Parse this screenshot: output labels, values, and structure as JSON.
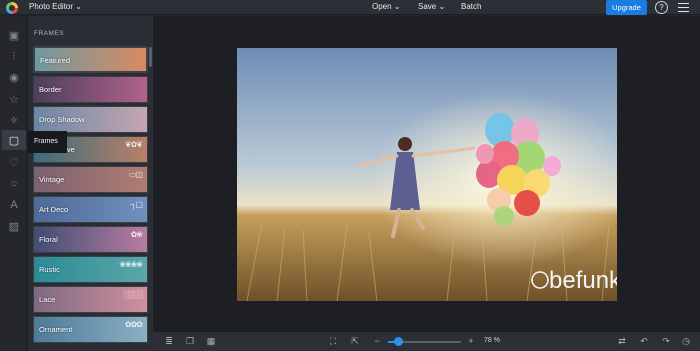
{
  "app": {
    "title": "Photo Editor"
  },
  "topmenu": {
    "open": "Open",
    "save": "Save",
    "batch": "Batch",
    "upgrade": "Upgrade",
    "help": "?"
  },
  "rail": {
    "icons": [
      "image-icon",
      "sliders-icon",
      "eye-icon",
      "star-icon",
      "atom-icon",
      "frames-icon",
      "heart-icon",
      "circle-icon",
      "text-icon",
      "texture-icon"
    ],
    "tooltip": "Frames"
  },
  "panel": {
    "heading": "FRAMES",
    "items": [
      {
        "label": "Featured",
        "bg1": "#6f9aa0",
        "bg2": "#d98a62"
      },
      {
        "label": "Border",
        "bg1": "#4b3f5e",
        "bg2": "#b2628a"
      },
      {
        "label": "Drop Shadow",
        "bg1": "#6b86a6",
        "bg2": "#c4a6b0"
      },
      {
        "label": "Decorative",
        "bg1": "#3b6c7a",
        "bg2": "#b98068"
      },
      {
        "label": "Vintage",
        "bg1": "#7b6170",
        "bg2": "#b07d72"
      },
      {
        "label": "Art Deco",
        "bg1": "#4e6a9a",
        "bg2": "#7190be"
      },
      {
        "label": "Floral",
        "bg1": "#3f4e74",
        "bg2": "#b97ba0"
      },
      {
        "label": "Rustic",
        "bg1": "#2b8b96",
        "bg2": "#5aa7a9"
      },
      {
        "label": "Lace",
        "bg1": "#7e6a82",
        "bg2": "#d28f9e"
      },
      {
        "label": "Ornament",
        "bg1": "#4e7b9a",
        "bg2": "#8bb0c3"
      }
    ]
  },
  "photo": {
    "watermark": "befunky"
  },
  "zoom": {
    "value": "78 %",
    "level": 0.15
  }
}
